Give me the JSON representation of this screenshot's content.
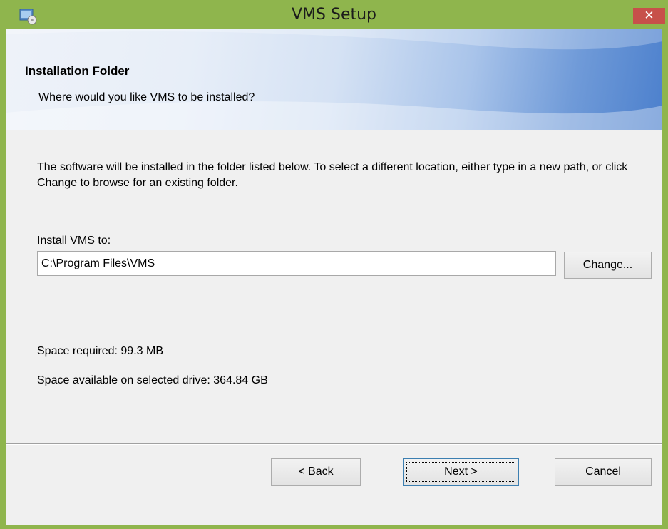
{
  "window": {
    "title": "VMS Setup",
    "close_symbol": "✕",
    "icon": "installer-icon"
  },
  "banner": {
    "title": "Installation Folder",
    "subtitle": "Where would you like VMS to be installed?"
  },
  "body": {
    "description": "The software will be installed in the folder listed below. To select a different location, either type in a new path, or click Change to browse for an existing folder.",
    "install_label": "Install VMS to:",
    "install_path": "C:\\Program Files\\VMS",
    "space_required": "Space required: 99.3 MB",
    "space_available": "Space available on selected drive: 364.84 GB"
  },
  "buttons": {
    "change": {
      "prefix": "C",
      "accel": "h",
      "suffix": "ange..."
    },
    "back": {
      "prefix": "< ",
      "accel": "B",
      "suffix": "ack"
    },
    "next": {
      "prefix": "",
      "accel": "N",
      "suffix": "ext >"
    },
    "cancel": {
      "prefix": "",
      "accel": "C",
      "suffix": "ancel"
    }
  },
  "colors": {
    "frame": "#8fb54d",
    "close_button": "#c7504a",
    "dialog_bg": "#f0f0f0"
  }
}
